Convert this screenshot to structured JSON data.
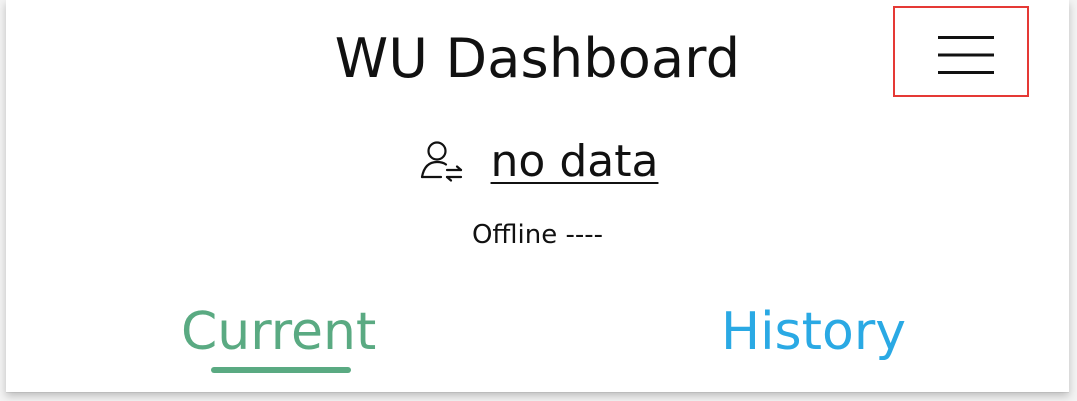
{
  "header": {
    "title": "WU Dashboard",
    "menu_icon": "hamburger-menu-icon",
    "highlight_color": "#e53935"
  },
  "account": {
    "icon": "user-switch-icon",
    "name": "no data"
  },
  "status": {
    "text": "Offline ----"
  },
  "tabs": [
    {
      "label": "Current",
      "active": true,
      "color": "#5aaa82"
    },
    {
      "label": "History",
      "active": false,
      "color": "#2aa9e4"
    }
  ]
}
